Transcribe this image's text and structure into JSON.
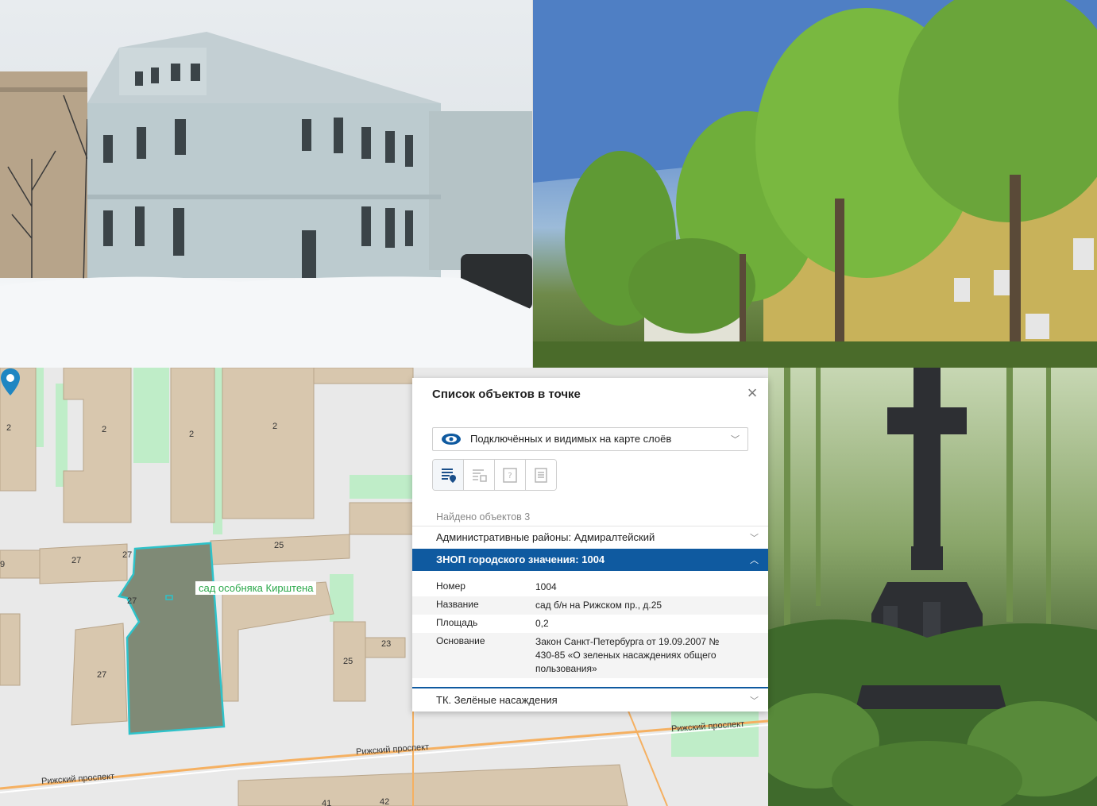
{
  "map": {
    "house_numbers": [
      "2",
      "2",
      "2",
      "2",
      "27",
      "27",
      "25",
      "9",
      "27",
      "23",
      "25",
      "27",
      "41",
      "42"
    ],
    "garden_label": "сад особняка Кирштена",
    "streets": [
      "Рижский проспект",
      "Рижский проспект",
      "Рижский проспект"
    ]
  },
  "panel": {
    "title": "Список объектов в точке",
    "layer_select": "Подключённых и видимых на карте слоёв",
    "found": "Найдено объектов 3",
    "items": [
      {
        "label": "Административные районы: Адмиралтейский"
      },
      {
        "label": "ЗНОП городского значения: 1004"
      },
      {
        "label": "ТК. Зелёные насаждения"
      }
    ],
    "details": [
      {
        "key": "Номер",
        "value": "1004"
      },
      {
        "key": "Название",
        "value": "сад б/н на Рижском пр., д.25"
      },
      {
        "key": "Площадь",
        "value": "0,2"
      },
      {
        "key": "Основание",
        "value": "Закон Санкт-Петербурга от 19.09.2007 № 430-85 «О зеленых насаждениях общего пользования»"
      }
    ]
  },
  "icons": [
    "close-icon",
    "layers-eye-icon",
    "chevron-down-icon",
    "list-pin-icon",
    "list-grid-icon",
    "question-doc-icon",
    "document-icon",
    "map-marker-icon"
  ],
  "colors": {
    "accent": "#0f5aa0",
    "garden_text": "#2aa84a",
    "parcel_fill": "#7f8a76",
    "parcel_border": "#2ec2c9"
  }
}
